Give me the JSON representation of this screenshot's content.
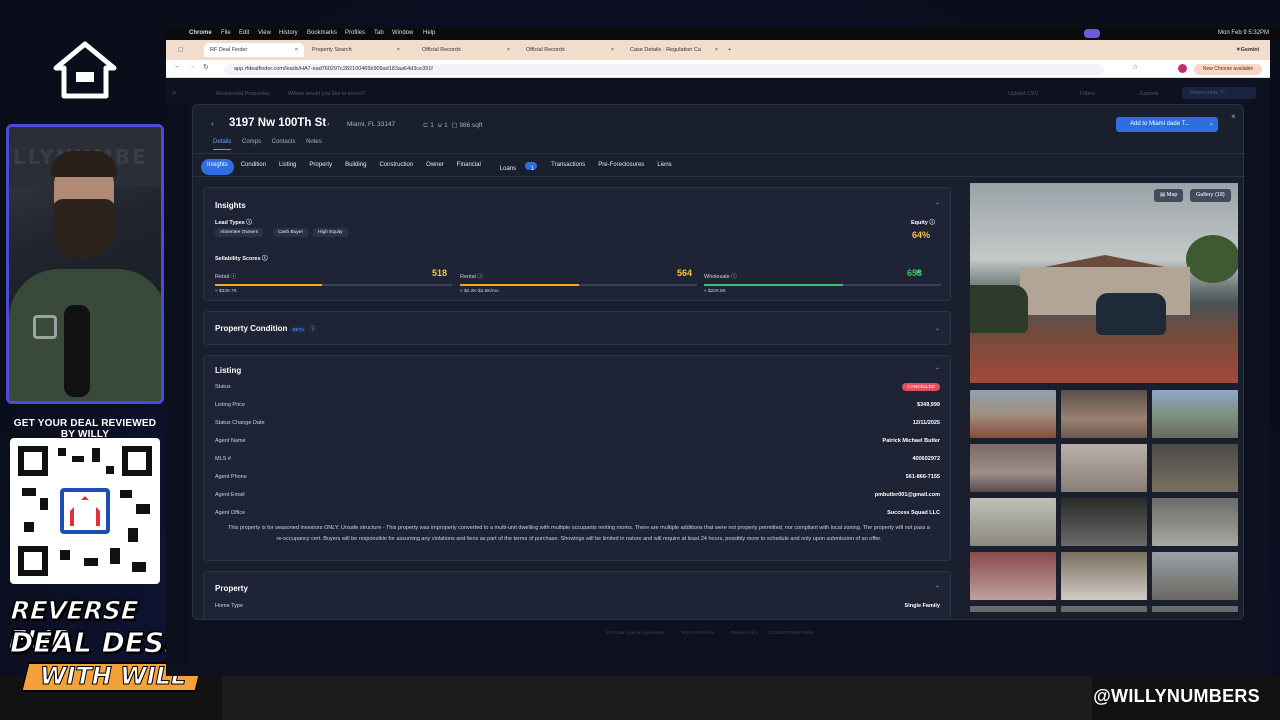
{
  "overlay": {
    "cta": "GET YOUR DEAL REVIEWED BY WILLY",
    "banner_line1": "REVERSE FLIP",
    "banner_line2": "DEAL DESK",
    "banner_line3": "WITH WILL",
    "handle": "@WILLYNUMBERS",
    "cam_watermark": "LLYNUMBE"
  },
  "menubar": {
    "app": "Chrome",
    "items": [
      "File",
      "Edit",
      "View",
      "History",
      "Bookmarks",
      "Profiles",
      "Tab",
      "Window",
      "Help"
    ],
    "clock": "Mon Feb 9  5:32PM"
  },
  "browser": {
    "tabs": [
      "RF Deal Finder",
      "Property Search",
      "Official Records",
      "Official Records",
      "Case Details - Regulation Ca"
    ],
    "url": "app.rfdealfinder.com/leads/HA7-ead760297c282100465b909ad183aa64d3ce391f",
    "new_chrome": "New Chrome available",
    "gemini": "Gemini"
  },
  "appbar": {
    "breadcrumb": "Residential Properties",
    "search_placeholder": "Where would you like to invest?",
    "upload": "Upload CSV",
    "filters": "Filters",
    "exports": "Exports",
    "list": "Miami dade Tr..."
  },
  "header": {
    "address": "3197 Nw 100Th St",
    "city": "Miami, FL 33147",
    "beds": "1",
    "baths": "1",
    "sqft": "986 sqft",
    "add_button": "Add to Miami dade T..."
  },
  "subtabs": [
    "Details",
    "Comps",
    "Contacts",
    "Notes"
  ],
  "navtabs": [
    "Insights",
    "Condition",
    "Listing",
    "Property",
    "Building",
    "Construction",
    "Owner",
    "Financial",
    "Loans",
    "Transactions",
    "Pre-Foreclosures",
    "Liens"
  ],
  "loans_badge": "1",
  "insights": {
    "title": "Insights",
    "lead_types_label": "Lead Types",
    "lead_types": [
      "Absentee Owners",
      "Cash Buyer",
      "High Equity"
    ],
    "equity_label": "Equity",
    "equity": "64%",
    "sellability_label": "Sellability Scores",
    "scores": [
      {
        "label": "Retail",
        "value": "518",
        "sub": "≈ $339.7K",
        "fill": 0.5,
        "color": "#f5a623"
      },
      {
        "label": "Rental",
        "value": "564",
        "sub": "≈ $2.2K-$2.6K/mo",
        "fill": 0.56,
        "color": "#f5a623"
      },
      {
        "label": "Wholesale",
        "value": "653",
        "sub": "≈ $228.8K",
        "fill": 0.65,
        "color": "#3ec26b"
      }
    ]
  },
  "condition": {
    "title": "Property Condition",
    "beta": "BETA"
  },
  "listing": {
    "title": "Listing",
    "rows": [
      {
        "label": "Status",
        "value": "CANCELLED"
      },
      {
        "label": "Listing Price",
        "value": "$349,999"
      },
      {
        "label": "Status Change Date",
        "value": "12/11/2025"
      },
      {
        "label": "Agent Name",
        "value": "Patrick Michael Butler"
      },
      {
        "label": "MLS #",
        "value": "400602972"
      },
      {
        "label": "Agent Phone",
        "value": "561-866-7155"
      },
      {
        "label": "Agent Email",
        "value": "pmbutler001@gmail.com"
      },
      {
        "label": "Agent Office",
        "value": "Success Squad LLC"
      }
    ],
    "description": "This property is for seasoned investors ONLY. Unsafe structure - This property was improperly converted to a multi-unit dwelling with multiple occupants renting rooms. There are multiple additions that were not properly permitted, nor compliant with local zoning. The property will not pass a re-occupancy cert. Buyers will be responsible for assuming any violations and liens as part of the terms of purchase. Showings will be limited in nature and will require at least 24 hours, possibly more to schedule and only upon submission of an offer."
  },
  "property": {
    "title": "Property",
    "home_type_label": "Home Type",
    "home_type": "Single Family"
  },
  "gallery": {
    "map": "Map",
    "gallery": "Gallery (18)"
  },
  "footer": {
    "links": [
      "End User License Agreement",
      "Terms of Service",
      "Privacy Policy",
      "© 2026 RF Deal Finder"
    ]
  }
}
